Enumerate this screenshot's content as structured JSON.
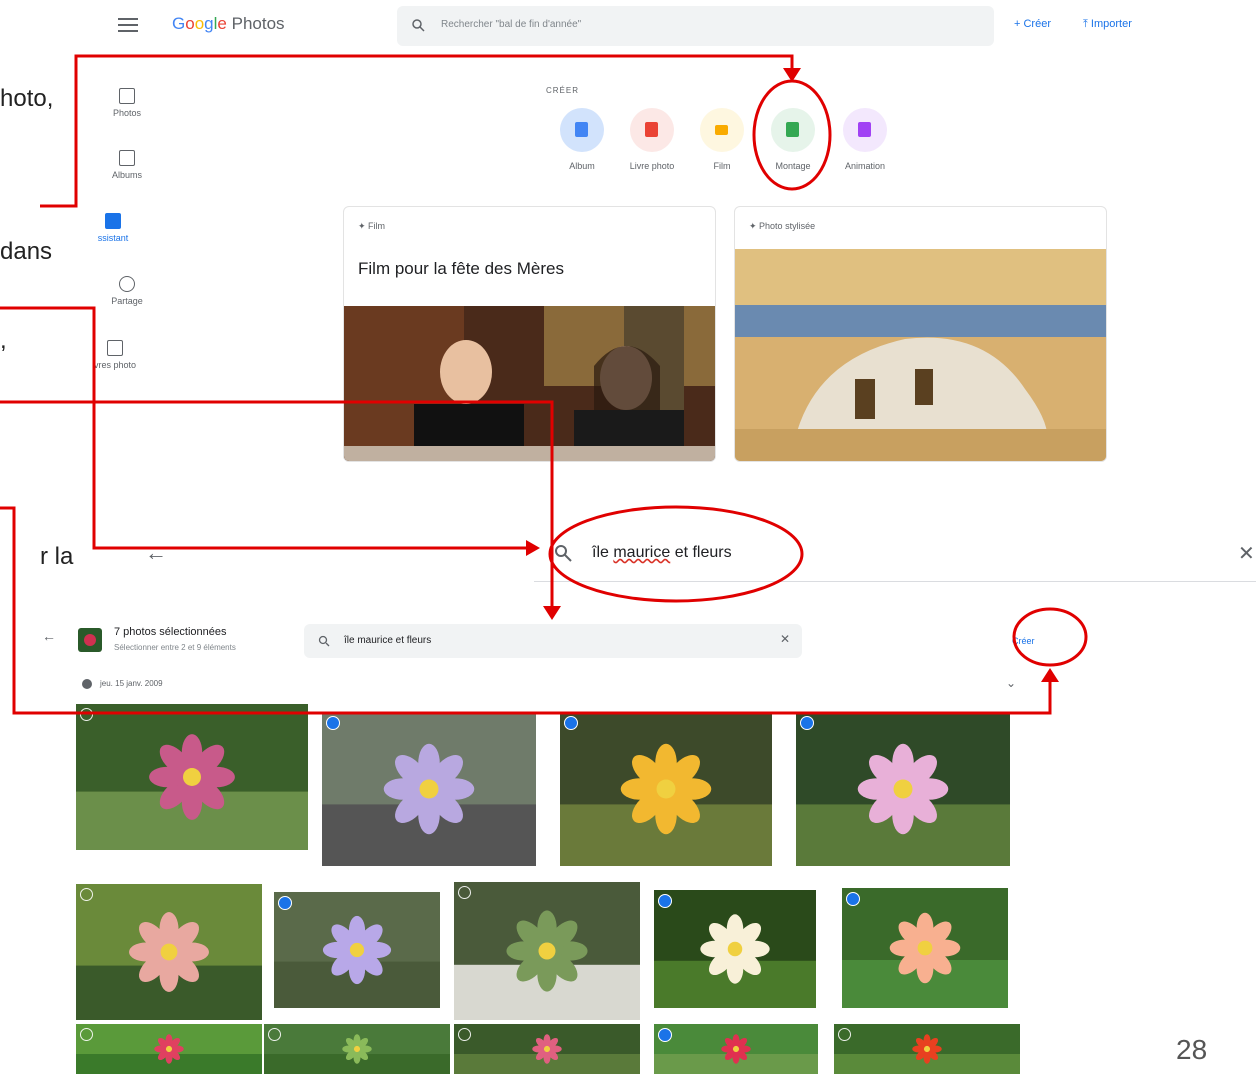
{
  "slide_fragments": [
    "hoto,",
    "dans",
    ",",
    "r la"
  ],
  "page_number": "28",
  "top_bar": {
    "logo_google": "Google",
    "logo_photos": "Photos",
    "search_placeholder": "Rechercher \"bal de fin d'année\"",
    "create_label": "+ Créer",
    "import_label": "Importer"
  },
  "nav": [
    {
      "label": "Photos"
    },
    {
      "label": "Albums"
    },
    {
      "label": "ssistant"
    },
    {
      "label": "Partage"
    },
    {
      "label": "vres photo"
    }
  ],
  "create": {
    "title": "CRÉER",
    "items": [
      {
        "label": "Album",
        "color": "#d2e3fc",
        "icon_color": "#4285f4"
      },
      {
        "label": "Livre photo",
        "color": "#fce8e6",
        "icon_color": "#ea4335"
      },
      {
        "label": "Film",
        "color": "#fef7e0",
        "icon_color": "#f9ab00"
      },
      {
        "label": "Montage",
        "color": "#e6f4ea",
        "icon_color": "#34a853"
      },
      {
        "label": "Animation",
        "color": "#f3e8fd",
        "icon_color": "#a142f4"
      }
    ]
  },
  "cards": [
    {
      "type": "Film",
      "title": "Film pour la fête des Mères"
    },
    {
      "type": "Photo stylisée",
      "title": ""
    }
  ],
  "big_search": {
    "value_prefix": "île ",
    "value_squiggle": "maurice",
    "value_suffix": " et fleurs"
  },
  "selection": {
    "count_label": "7 photos sélectionnées",
    "hint": "Sélectionner entre 2 et 9 éléments",
    "search_value": "île maurice et fleurs",
    "create_label": "Créer",
    "date_label": "jeu. 15 janv. 2009"
  },
  "annotation_color": "#e00000",
  "photos": [
    {
      "checked": false,
      "colors": [
        "#3a5f2a",
        "#c85a8a",
        "#6b8f4a"
      ]
    },
    {
      "checked": true,
      "colors": [
        "#6f7b6a",
        "#b8a8e0",
        "#555555"
      ]
    },
    {
      "checked": true,
      "colors": [
        "#3d4a2a",
        "#f2b830",
        "#6a7a3a"
      ]
    },
    {
      "checked": true,
      "colors": [
        "#2f4a28",
        "#e8b0d8",
        "#5a7a3a"
      ]
    },
    {
      "checked": false,
      "colors": [
        "#6a8a3a",
        "#e8a8a0",
        "#3a5a2a"
      ]
    },
    {
      "checked": true,
      "colors": [
        "#5a6a4a",
        "#b8a8e8",
        "#4a5a3a"
      ]
    },
    {
      "checked": false,
      "colors": [
        "#4a5a3a",
        "#7a9a5a",
        "#d8d8d0"
      ]
    },
    {
      "checked": true,
      "colors": [
        "#2a4a1a",
        "#f8f0d8",
        "#4a7a2a"
      ]
    },
    {
      "checked": true,
      "colors": [
        "#3a6a2a",
        "#f8b090",
        "#4a8a3a"
      ]
    },
    {
      "checked": false,
      "colors": [
        "#5a9a3a",
        "#e04060",
        "#3a7a2a"
      ]
    },
    {
      "checked": false,
      "colors": [
        "#4a7a3a",
        "#8aba5a",
        "#3a6a2a"
      ]
    },
    {
      "checked": false,
      "colors": [
        "#3a5a2a",
        "#e06080",
        "#5a7a3a"
      ]
    },
    {
      "checked": true,
      "colors": [
        "#4a8a3a",
        "#e03050",
        "#6a9a4a"
      ]
    },
    {
      "checked": false,
      "colors": [
        "#3a6a2a",
        "#e84020",
        "#5a8a3a"
      ]
    }
  ]
}
